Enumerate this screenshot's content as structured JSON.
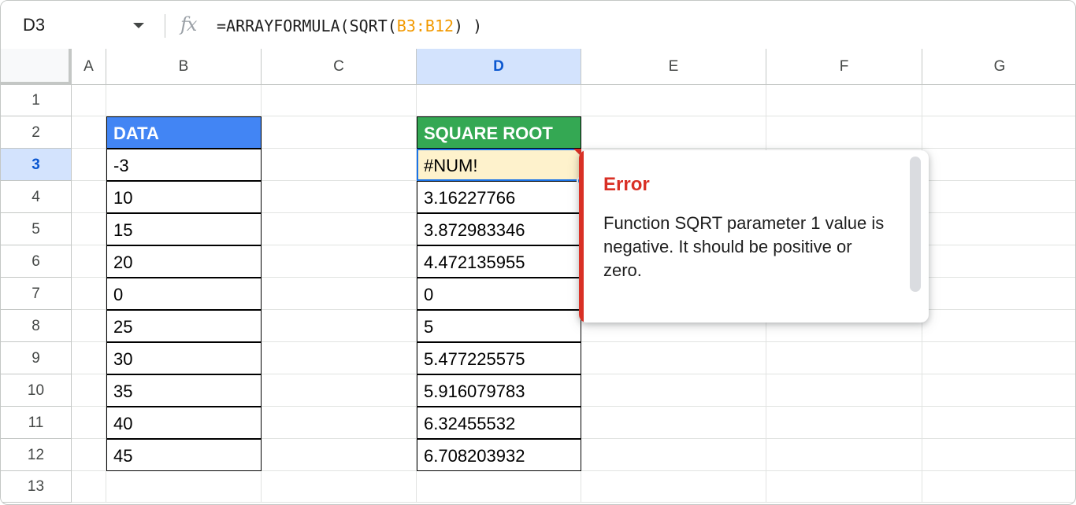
{
  "formula_bar": {
    "name_box": "D3",
    "fx_icon": "fx-icon",
    "formula_prefix": "=ARRAYFORMULA(SQRT(",
    "formula_ref": "B3:B12",
    "formula_suffix": ") )"
  },
  "columns": [
    "A",
    "B",
    "C",
    "D",
    "E",
    "F",
    "G"
  ],
  "selected_column": "D",
  "rows": [
    "1",
    "2",
    "3",
    "4",
    "5",
    "6",
    "7",
    "8",
    "9",
    "10",
    "11",
    "12",
    "13"
  ],
  "selected_row": "3",
  "data_header": "DATA",
  "result_header": "SQUARE ROOT",
  "data_values": [
    "-3",
    "10",
    "15",
    "20",
    "0",
    "25",
    "30",
    "35",
    "40",
    "45"
  ],
  "result_values": [
    "#NUM!",
    "3.16227766",
    "3.872983346",
    "4.472135955",
    "0",
    "5",
    "5.477225575",
    "5.916079783",
    "6.32455532",
    "6.708203932"
  ],
  "error_popup": {
    "title": "Error",
    "message": "Function SQRT parameter 1 value is negative. It should be positive or zero."
  },
  "colors": {
    "data_header_bg": "#4285f4",
    "result_header_bg": "#34a853",
    "error_red": "#d93025",
    "selection_blue": "#1a73e8",
    "formula_ref": "#f29900"
  }
}
